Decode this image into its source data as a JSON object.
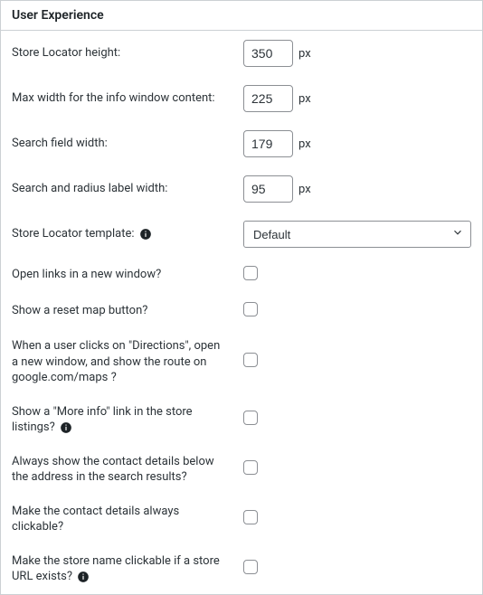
{
  "header": {
    "title": "User Experience"
  },
  "fields": {
    "height": {
      "label": "Store Locator height:",
      "value": "350",
      "unit": "px"
    },
    "maxwidth": {
      "label": "Max width for the info window content:",
      "value": "225",
      "unit": "px"
    },
    "searchwidth": {
      "label": "Search field width:",
      "value": "179",
      "unit": "px"
    },
    "labelwidth": {
      "label": "Search and radius label width:",
      "value": "95",
      "unit": "px"
    },
    "template": {
      "label": "Store Locator template:",
      "selected": "Default"
    },
    "newwindow": {
      "label": "Open links in a new window?"
    },
    "reset": {
      "label": "Show a reset map button?"
    },
    "directions": {
      "label": "When a user clicks on \"Directions\", open a new window, and show the route on google.com/maps ?"
    },
    "moreinfo": {
      "label": "Show a \"More info\" link in the store listings?"
    },
    "contactalways": {
      "label": "Always show the contact details below the address in the search results?"
    },
    "contactclick": {
      "label": "Make the contact details always clickable?"
    },
    "nameclick": {
      "label": "Make the store name clickable if a store URL exists?"
    }
  },
  "icons": {
    "info": "info-icon",
    "chevron": "chevron-down-icon"
  }
}
